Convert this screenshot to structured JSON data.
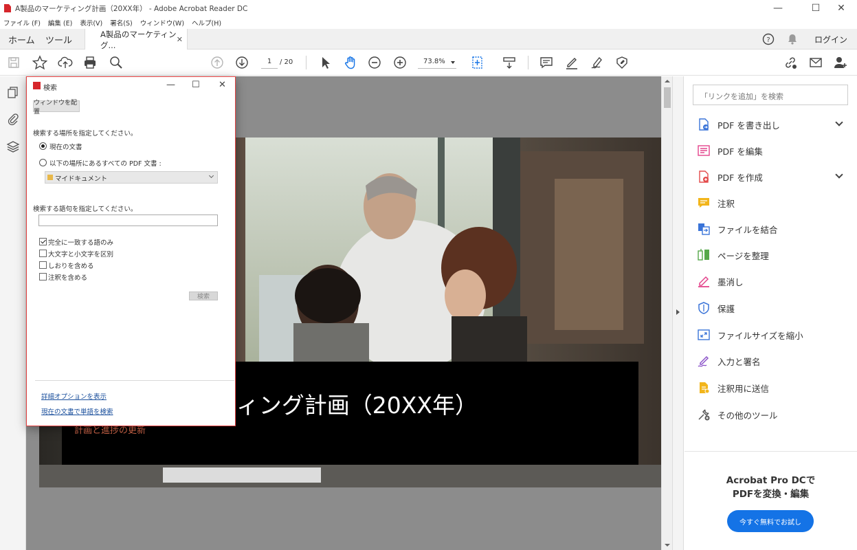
{
  "window": {
    "title": "A製品のマーケティング計画（20XX年） - Adobe Acrobat Reader DC",
    "minimize": "—",
    "maximize": "☐",
    "close": "✕"
  },
  "menu": [
    "ファイル (F)",
    "編集 (E)",
    "表示(V)",
    "署名(S)",
    "ウィンドウ(W)",
    "ヘルプ(H)"
  ],
  "tabs": {
    "home": "ホーム",
    "tools": "ツール",
    "doc": "A製品のマーケティング...",
    "doc_close": "✕",
    "login": "ログイン"
  },
  "toolbar": {
    "page_current": "1",
    "page_total": "/ 20",
    "zoom": "73.8%"
  },
  "document": {
    "title": "ティング計画（20XX年）",
    "subtitle": "計画と進捗の更新"
  },
  "search_dialog": {
    "title": "検索",
    "arrange_button": "ウィンドウを配置",
    "where_label": "検索する場所を指定してください。",
    "option_current": "現在の文書",
    "option_all_pdfs": "以下の場所にあるすべての PDF 文書 :",
    "location": "マイドキュメント",
    "term_label": "検索する語句を指定してください。",
    "term_value": "",
    "checkboxes": [
      {
        "label": "完全に一致する語のみ",
        "checked": true
      },
      {
        "label": "大文字と小文字を区別",
        "checked": false
      },
      {
        "label": "しおりを含める",
        "checked": false
      },
      {
        "label": "注釈を含める",
        "checked": false
      }
    ],
    "search_button": "検索",
    "link_advanced": "詳細オプションを表示",
    "link_find_in_doc": "現在の文書で単語を検索"
  },
  "right_panel": {
    "search_placeholder": "「リンクを追加」を検索",
    "tools": [
      {
        "label": "PDF を書き出し",
        "icon": "export-pdf-icon",
        "color": "#3a74d8",
        "expand": true
      },
      {
        "label": "PDF を編集",
        "icon": "edit-pdf-icon",
        "color": "#e3438b",
        "expand": false
      },
      {
        "label": "PDF を作成",
        "icon": "create-pdf-icon",
        "color": "#e34b4b",
        "expand": true
      },
      {
        "label": "注釈",
        "icon": "comment-icon",
        "color": "#f2b51b",
        "expand": false
      },
      {
        "label": "ファイルを結合",
        "icon": "combine-files-icon",
        "color": "#3a74d8",
        "expand": false
      },
      {
        "label": "ページを整理",
        "icon": "organize-pages-icon",
        "color": "#55a84a",
        "expand": false
      },
      {
        "label": "墨消し",
        "icon": "redact-icon",
        "color": "#e3438b",
        "expand": false
      },
      {
        "label": "保護",
        "icon": "protect-icon",
        "color": "#3a74d8",
        "expand": false
      },
      {
        "label": "ファイルサイズを縮小",
        "icon": "compress-icon",
        "color": "#3a74d8",
        "expand": false
      },
      {
        "label": "入力と署名",
        "icon": "fill-sign-icon",
        "color": "#8b54c9",
        "expand": false
      },
      {
        "label": "注釈用に送信",
        "icon": "send-comments-icon",
        "color": "#f2b51b",
        "expand": false
      },
      {
        "label": "その他のツール",
        "icon": "more-tools-icon",
        "color": "#555555",
        "expand": false
      }
    ],
    "promo_line1": "Acrobat Pro DCで",
    "promo_line2": "PDFを変換・編集",
    "promo_button": "今すぐ無料でお試し"
  },
  "colors": {
    "accent": "#1473e6",
    "brand_red": "#d6262b"
  }
}
